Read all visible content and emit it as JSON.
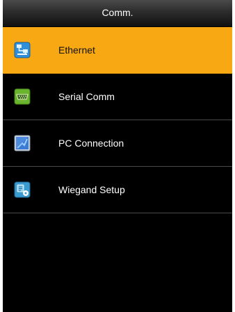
{
  "window": {
    "title": "Comm."
  },
  "menu": {
    "items": [
      {
        "label": "Ethernet",
        "icon": "ethernet-icon",
        "selected": true
      },
      {
        "label": "Serial Comm",
        "icon": "serial-port-icon",
        "selected": false
      },
      {
        "label": "PC Connection",
        "icon": "pc-connection-icon",
        "selected": false
      },
      {
        "label": "Wiegand Setup",
        "icon": "wiegand-icon",
        "selected": false
      }
    ]
  },
  "colors": {
    "highlight": "#f7a812",
    "background": "#000000",
    "divider": "#4a4a4a",
    "title_text": "#ffffff"
  }
}
